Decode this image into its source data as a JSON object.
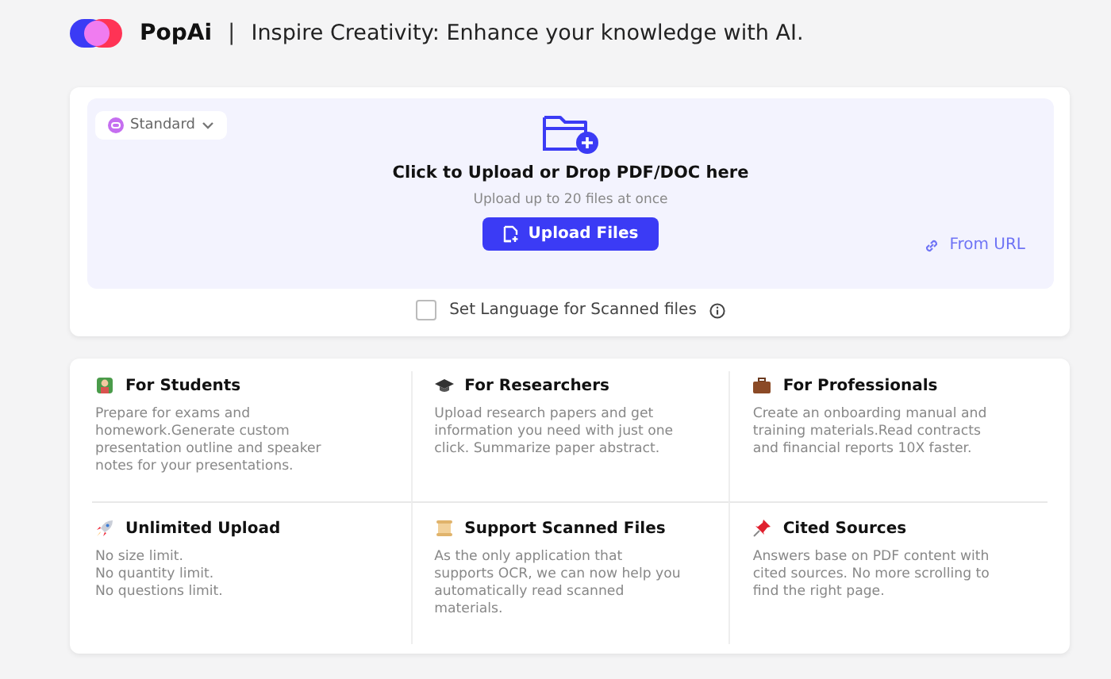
{
  "header": {
    "brand": "PopAi",
    "separator": "|",
    "tagline": "Inspire Creativity: Enhance your knowledge with AI."
  },
  "upload": {
    "mode": "Standard",
    "title": "Click to Upload or Drop PDF/DOC here",
    "subtitle": "Upload up to 20 files at once",
    "button": "Upload Files",
    "url_link": "From URL",
    "language_option": {
      "label": "Set Language for Scanned files",
      "checked": false
    }
  },
  "features": [
    {
      "kind": "student",
      "title": "For Students",
      "text": "Prepare for exams and homework.Generate custom presentation outline and speaker notes for your presentations."
    },
    {
      "kind": "cap",
      "title": "For Researchers",
      "text": "Upload research papers and get information you need with just one click. Summarize paper abstract."
    },
    {
      "kind": "briefcase",
      "title": "For Professionals",
      "text": "Create an onboarding manual and training materials.Read contracts and financial reports 10X faster."
    },
    {
      "kind": "rocket",
      "title": "Unlimited Upload",
      "text": "No size limit.\nNo quantity limit.\nNo questions limit."
    },
    {
      "kind": "scroll",
      "title": "Support Scanned Files",
      "text": "As the only application that supports OCR, we can now help you automatically read scanned materials."
    },
    {
      "kind": "pin",
      "title": "Cited Sources",
      "text": "Answers base on PDF content with cited sources. No more scrolling to find the right page."
    }
  ]
}
